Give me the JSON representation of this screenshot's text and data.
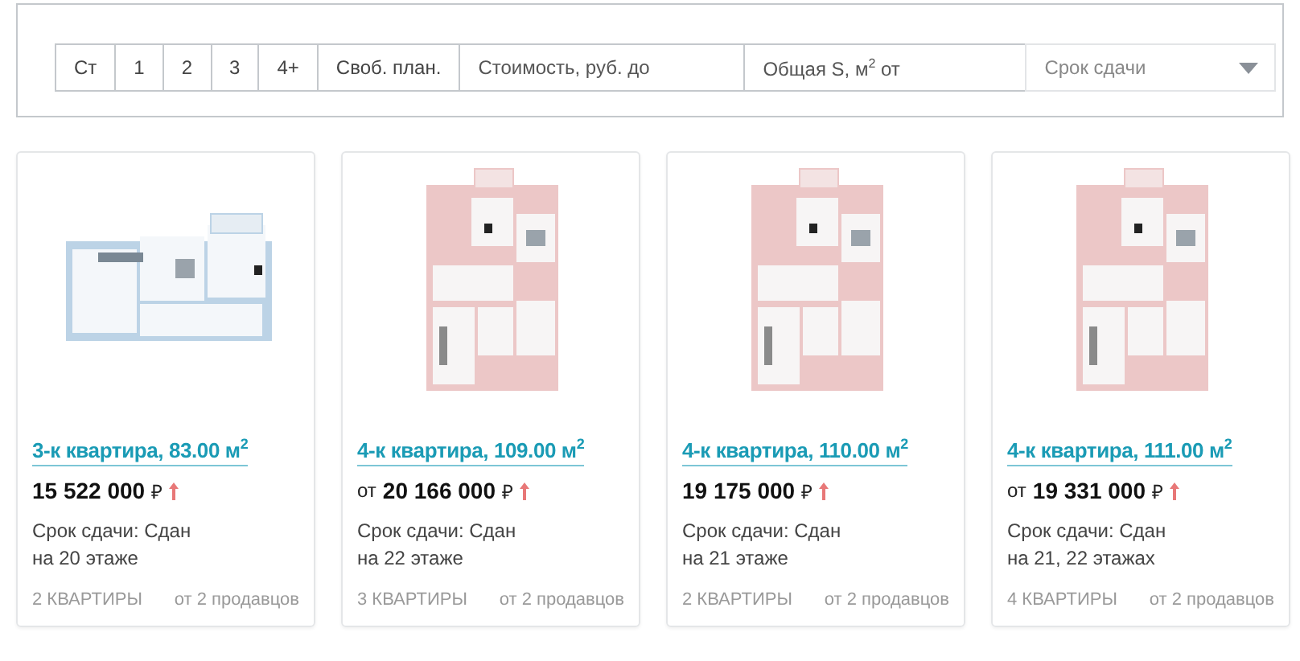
{
  "filters": {
    "rooms": [
      {
        "label": "Ст",
        "selected": false
      },
      {
        "label": "1",
        "selected": false
      },
      {
        "label": "2",
        "selected": false
      },
      {
        "label": "3",
        "selected": false
      },
      {
        "label": "4+",
        "selected": false
      },
      {
        "label": "Своб. план.",
        "selected": false
      }
    ],
    "price_field": {
      "placeholder": "Стоимость, руб. до"
    },
    "area_field": {
      "placeholder": "Общая S, м$^{2}$ от"
    },
    "deadline_select": {
      "placeholder": "Срок сдачи"
    }
  },
  "cards": [
    {
      "title": "3-к квартира, 83.00 м$^{2}$",
      "price": "15 522 000",
      "currency": "₽",
      "term": "Срок сдачи: Сдан",
      "floor": "на 20 этаже",
      "count": "2 КВАРТИРЫ",
      "sellers": "от 2 продавцов"
    },
    {
      "title": "4-к квартира, 109.00 м$^{2}$",
      "price_prefix": "от",
      "price": "20 166 000",
      "currency": "₽",
      "term": "Срок сдачи: Сдан",
      "floor": "на 22 этаже",
      "count": "3 КВАРТИРЫ",
      "sellers": "от 2 продавцов"
    },
    {
      "title": "4-к квартира, 110.00 м$^{2}$",
      "price": "19 175 000",
      "currency": "₽",
      "term": "Срок сдачи: Сдан",
      "floor": "на 21 этаже",
      "count": "2 КВАРТИРЫ",
      "sellers": "от 2 продавцов"
    },
    {
      "title": "4-к квартира, 111.00 м$^{2}$",
      "price_prefix": "от",
      "price": "19 331 000",
      "currency": "₽",
      "term": "Срок сдачи: Сдан",
      "floor": "на 21, 22 этажах",
      "count": "4 КВАРТИРЫ",
      "sellers": "от 2 продавцов"
    }
  ]
}
